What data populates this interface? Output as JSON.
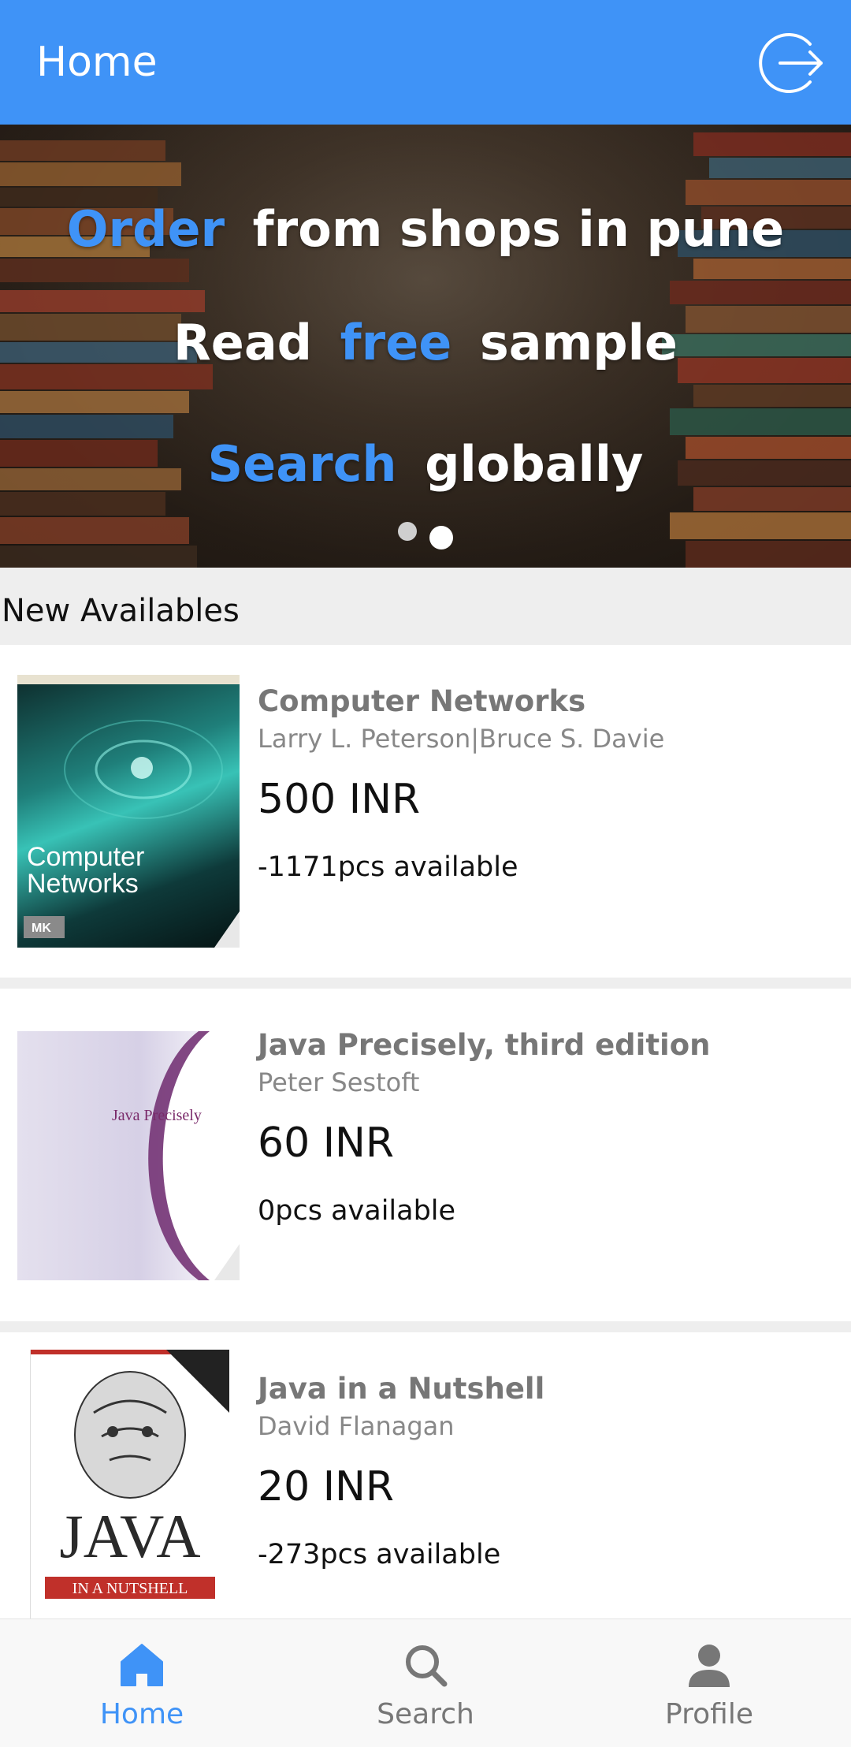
{
  "appbar": {
    "title": "Home",
    "logout_icon": "logout-icon"
  },
  "banner": {
    "lines": [
      {
        "highlight": "Order",
        "rest": "from shops in pune"
      },
      {
        "pre": "Read",
        "highlight": "free",
        "post": "sample"
      },
      {
        "highlight": "Search",
        "rest": "globally"
      }
    ],
    "active_slide": 2,
    "slide_count": 2
  },
  "section": {
    "title": "New Availables"
  },
  "books": [
    {
      "title": "Computer Networks",
      "author": "Larry L. Peterson|Bruce S. Davie",
      "price": "500 INR",
      "stock": "-1171pcs available",
      "cover_text": "Computer Networks"
    },
    {
      "title": "Java Precisely, third edition",
      "author": "Peter Sestoft",
      "price": "60 INR",
      "stock": "0pcs available",
      "cover_text": "Java Precisely"
    },
    {
      "title": "Java in a Nutshell",
      "author": "David Flanagan",
      "price": "20 INR",
      "stock": "-273pcs available",
      "cover_text": "JAVA",
      "cover_subtext": "IN A NUTSHELL"
    }
  ],
  "nav": [
    {
      "label": "Home",
      "icon": "home-icon",
      "active": true
    },
    {
      "label": "Search",
      "icon": "search-icon",
      "active": false
    },
    {
      "label": "Profile",
      "icon": "profile-icon",
      "active": false
    }
  ],
  "colors": {
    "primary": "#3f93f7",
    "inactive": "#777777",
    "divider": "#eeeeee"
  }
}
